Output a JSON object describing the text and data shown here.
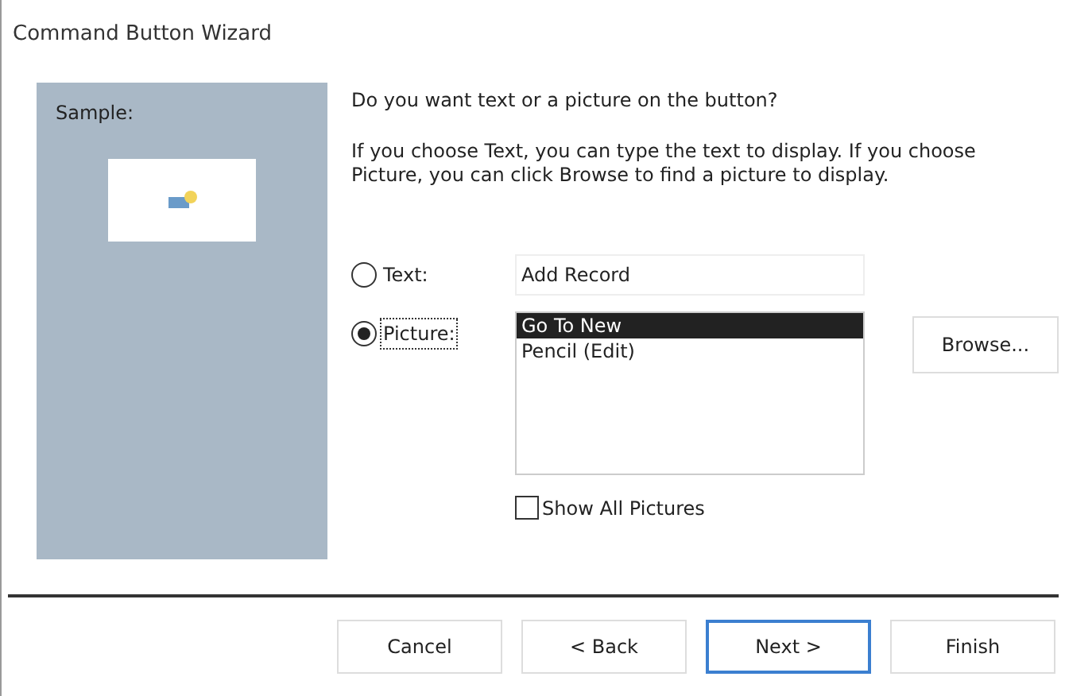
{
  "window": {
    "title": "Command Button Wizard"
  },
  "sample": {
    "label": "Sample:"
  },
  "question": "Do you want text or a picture on the button?",
  "instructions": "If you choose Text, you can type the text to display.  If you choose Picture, you can click Browse to find a picture to display.",
  "options": [
    {
      "label": "Text:",
      "selected": false,
      "kind": "text",
      "value": "Add Record"
    },
    {
      "label": "Picture:",
      "selected": true,
      "kind": "list",
      "items": [
        {
          "label": "Go To New",
          "selected": true
        },
        {
          "label": "Pencil (Edit)",
          "selected": false
        }
      ],
      "button": "Browse..."
    }
  ],
  "show_all": {
    "label": "Show All Pictures",
    "checked": false
  },
  "buttons": [
    {
      "label": "Cancel",
      "default": false
    },
    {
      "label": "< Back",
      "default": false
    },
    {
      "label": "Next >",
      "default": true
    },
    {
      "label": "Finish",
      "default": false
    }
  ]
}
